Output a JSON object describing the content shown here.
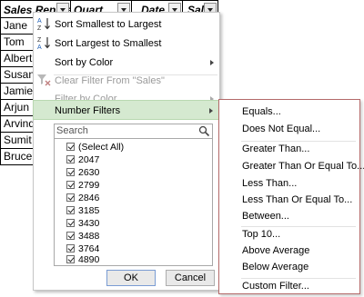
{
  "columns": [
    "Sales Rep Nan",
    "Quart",
    "Date",
    "Sales"
  ],
  "rows": [
    "Jane",
    "Tom",
    "Albert",
    "Susan",
    "Jamie",
    "Arjun",
    "Arvind",
    "Sumit",
    "Bruce"
  ],
  "menu": {
    "sort_asc": "Sort Smallest to Largest",
    "sort_desc": "Sort Largest to Smallest",
    "sort_color": "Sort by Color",
    "clear_filter": "Clear Filter From \"Sales\"",
    "filter_color": "Filter by Color",
    "number_filters": "Number Filters",
    "search_placeholder": "Search",
    "select_all": "(Select All)",
    "values": [
      "2047",
      "2630",
      "2799",
      "2846",
      "3185",
      "3430",
      "3488",
      "3764",
      "4890"
    ],
    "ok": "OK",
    "cancel": "Cancel"
  },
  "submenu": {
    "items": [
      "Equals...",
      "Does Not Equal...",
      "Greater Than...",
      "Greater Than Or Equal To...",
      "Less Than...",
      "Less Than Or Equal To...",
      "Between...",
      "Top 10...",
      "Above Average",
      "Below Average",
      "Custom Filter..."
    ]
  },
  "colors": {
    "hover_bg": "#d5e9d0",
    "submenu_border": "#b46a6a",
    "disabled_text": "#9a9a9a"
  },
  "icons": [
    "sort-ascending-icon",
    "sort-descending-icon",
    "clear-filter-icon",
    "search-icon",
    "checkbox-icon",
    "chevron-right-icon",
    "dropdown-arrow-icon"
  ]
}
